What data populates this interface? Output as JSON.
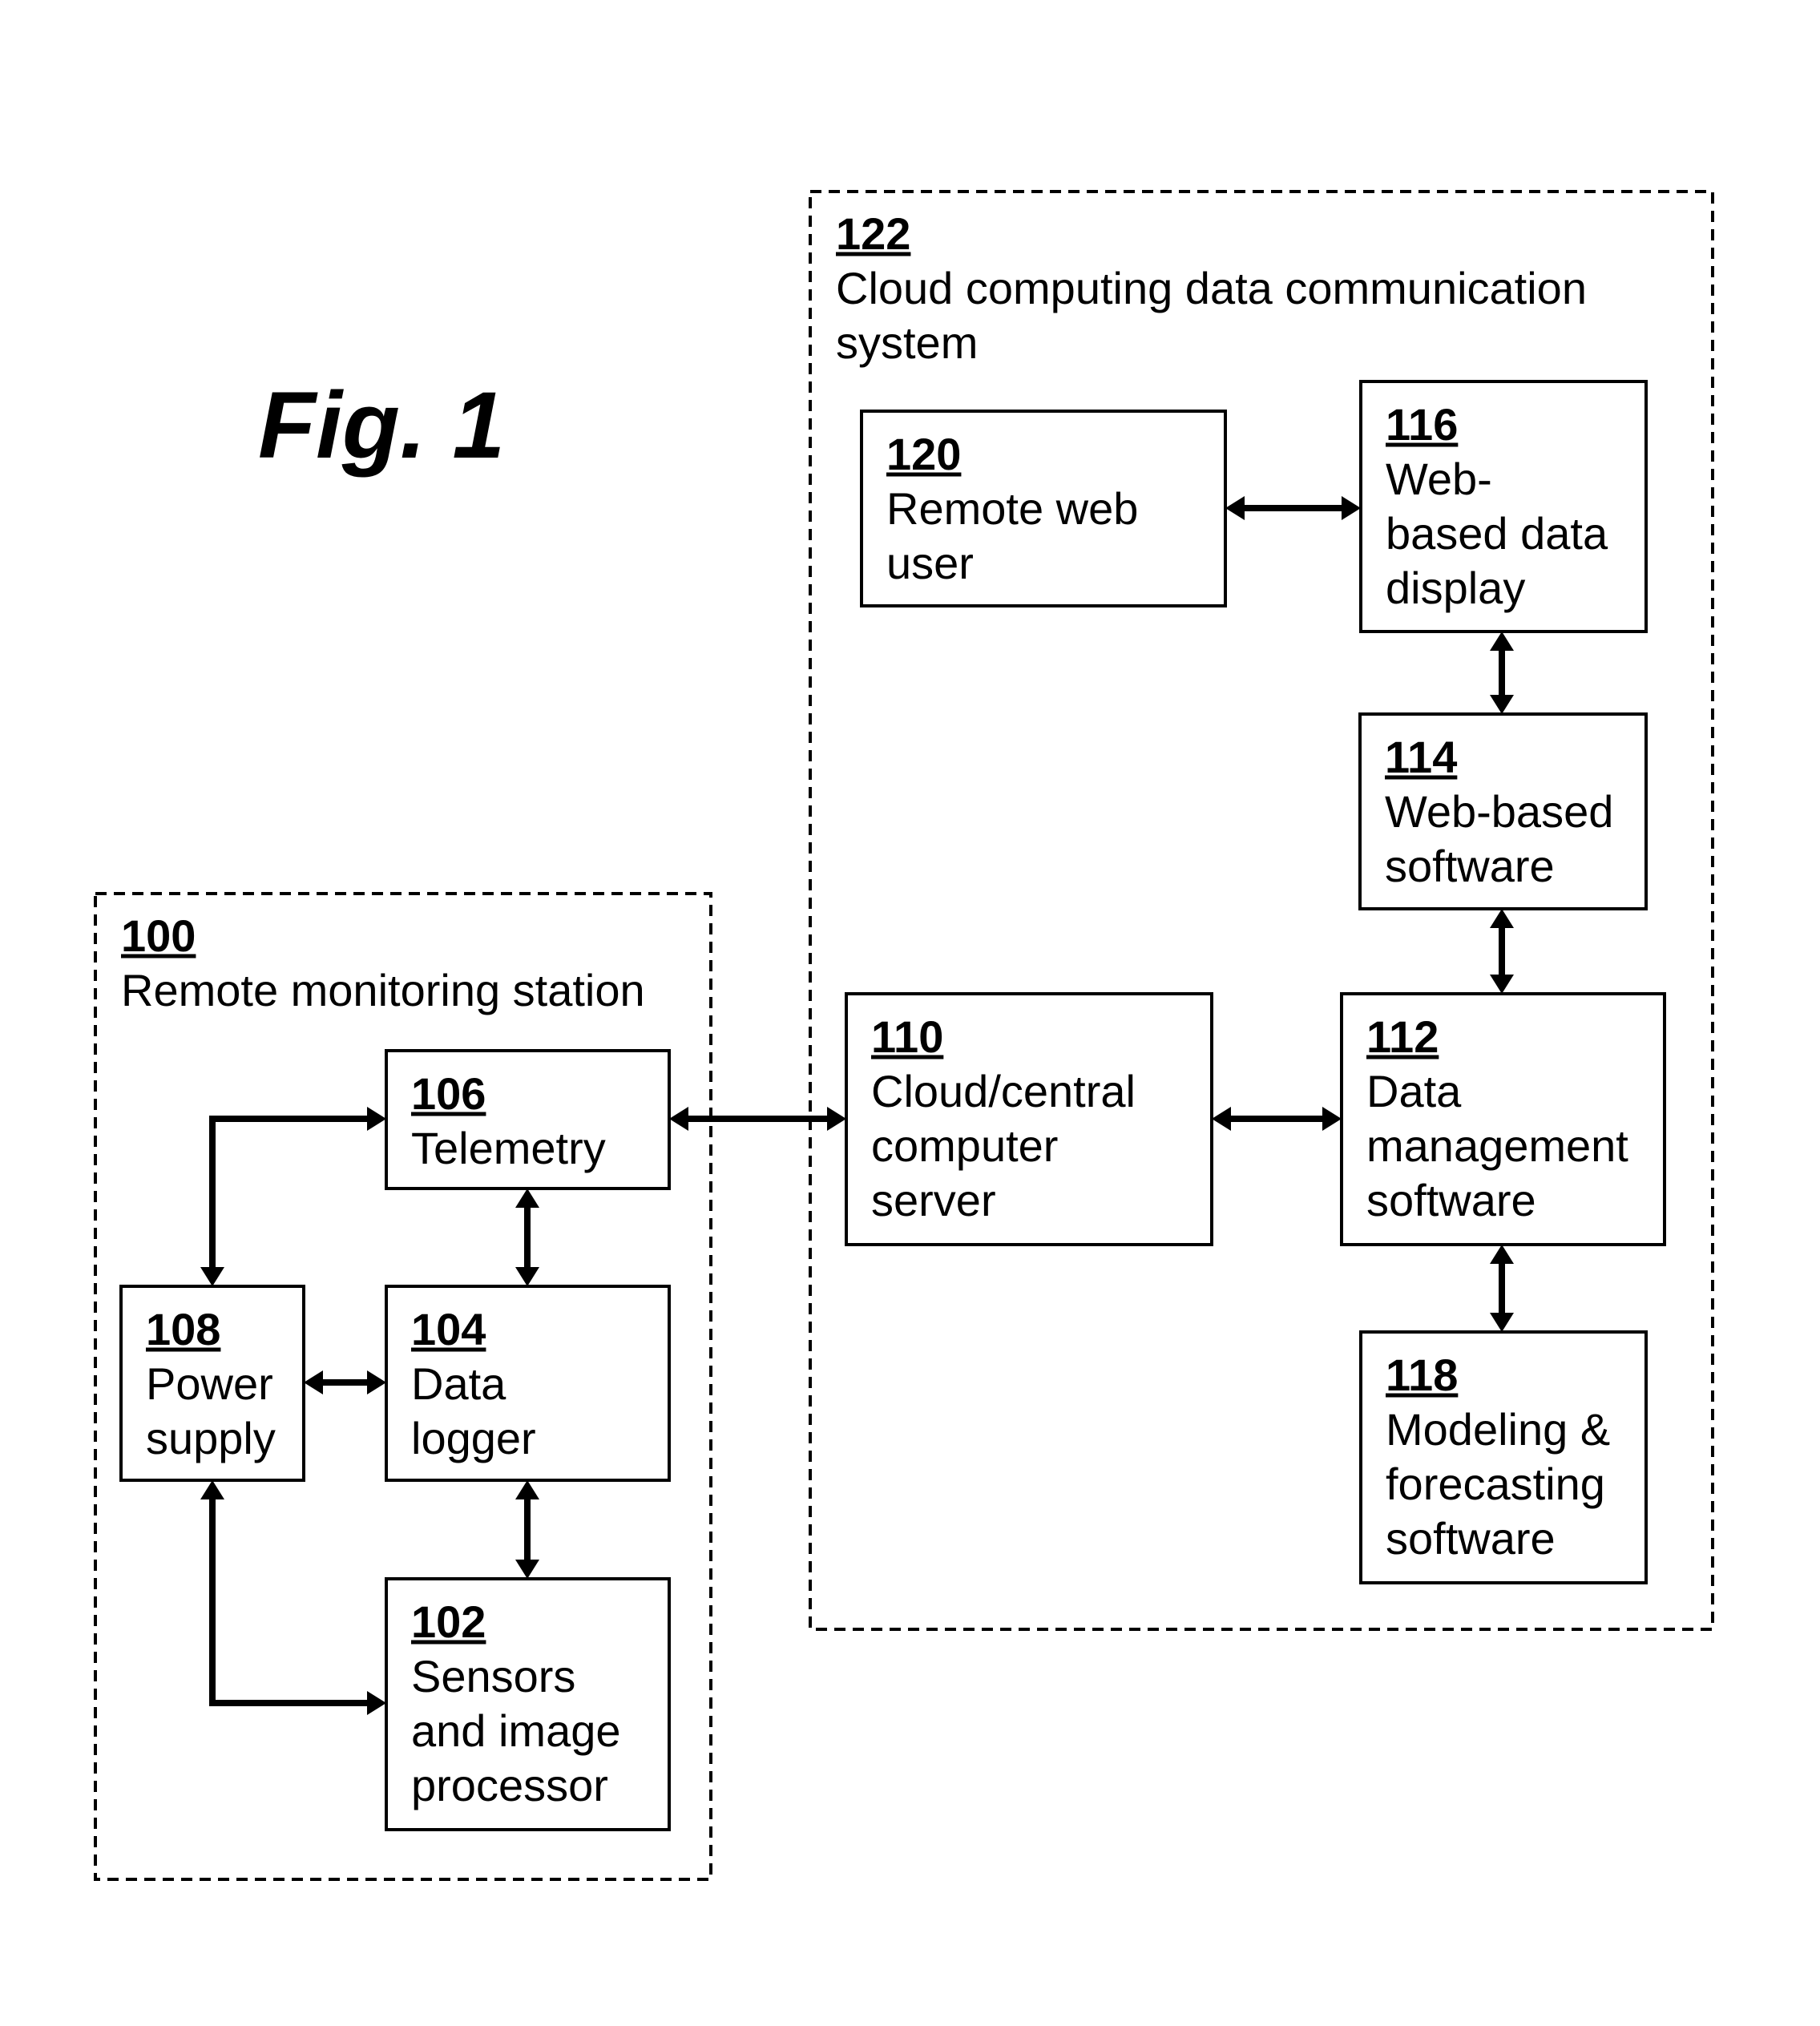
{
  "figure": {
    "title": "Fig. 1"
  },
  "groups": [
    {
      "id": "g122",
      "number": "122",
      "lines": [
        "Cloud computing data communication",
        "system"
      ]
    },
    {
      "id": "g100",
      "number": "100",
      "lines": [
        "Remote monitoring station"
      ]
    }
  ],
  "blocks": [
    {
      "id": "b120",
      "number": "120",
      "lines": [
        "Remote web",
        "user"
      ]
    },
    {
      "id": "b116",
      "number": "116",
      "lines": [
        "Web-",
        "based data",
        "display"
      ]
    },
    {
      "id": "b114",
      "number": "114",
      "lines": [
        "Web-based",
        "software"
      ]
    },
    {
      "id": "b110",
      "number": "110",
      "lines": [
        "Cloud/central",
        "computer",
        "server"
      ]
    },
    {
      "id": "b112",
      "number": "112",
      "lines": [
        "Data",
        "management",
        "software"
      ]
    },
    {
      "id": "b118",
      "number": "118",
      "lines": [
        "Modeling &",
        "forecasting",
        "software"
      ]
    },
    {
      "id": "b106",
      "number": "106",
      "lines": [
        "Telemetry"
      ]
    },
    {
      "id": "b108",
      "number": "108",
      "lines": [
        "Power",
        "supply"
      ]
    },
    {
      "id": "b104",
      "number": "104",
      "lines": [
        "Data",
        "logger"
      ]
    },
    {
      "id": "b102",
      "number": "102",
      "lines": [
        "Sensors",
        "and image",
        "processor"
      ]
    }
  ],
  "connections": [
    {
      "from": "120",
      "to": "116",
      "direction": "bidirectional"
    },
    {
      "from": "116",
      "to": "114",
      "direction": "bidirectional"
    },
    {
      "from": "114",
      "to": "112",
      "direction": "bidirectional"
    },
    {
      "from": "110",
      "to": "112",
      "direction": "bidirectional"
    },
    {
      "from": "112",
      "to": "118",
      "direction": "bidirectional"
    },
    {
      "from": "106",
      "to": "110",
      "direction": "bidirectional"
    },
    {
      "from": "106",
      "to": "104",
      "direction": "bidirectional"
    },
    {
      "from": "104",
      "to": "102",
      "direction": "bidirectional"
    },
    {
      "from": "108",
      "to": "104",
      "direction": "bidirectional"
    },
    {
      "from": "106",
      "to": "108",
      "direction": "bidirectional"
    },
    {
      "from": "108",
      "to": "102",
      "direction": "bidirectional"
    }
  ]
}
